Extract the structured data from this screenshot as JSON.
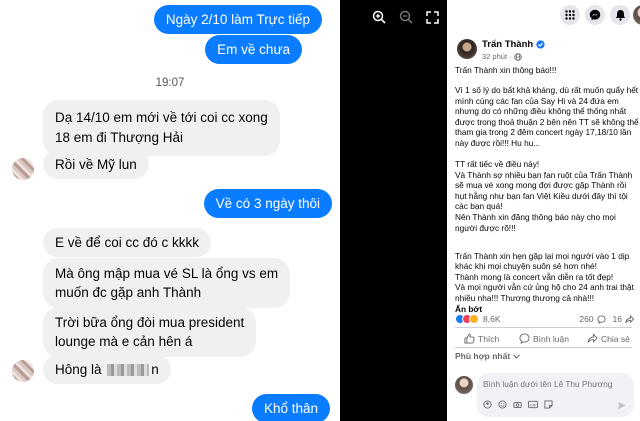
{
  "chat": {
    "messages": [
      {
        "side": "out",
        "text": "Ngày 2/10 làm Trực tiếp"
      },
      {
        "side": "out",
        "text": "Em về chưa"
      },
      {
        "side": "in",
        "text": "Dạ 14/10 em mới về tới coi cc xong"
      },
      {
        "side": "in",
        "text": "18 em đi Thượng Hải"
      },
      {
        "side": "in",
        "text": "Rồi về Mỹ lun"
      },
      {
        "side": "out",
        "text": "Về có 3 ngày thôi"
      },
      {
        "side": "in",
        "text": "E về để coi cc đó c kkkk"
      },
      {
        "side": "in",
        "text": "Mà ông mập mua vé SL là ổng vs em"
      },
      {
        "side": "in",
        "text": "muốn đc gặp anh Thành"
      },
      {
        "side": "in",
        "text": "Trời bữa ổng đòi mua president"
      },
      {
        "side": "in",
        "text": "lounge mà e cản hên á"
      },
      {
        "side": "in",
        "text_a": "Hông là ",
        "text_b": "n"
      },
      {
        "side": "out",
        "text": "Khổ thân"
      }
    ],
    "timestamp": "19:07"
  },
  "post": {
    "author": "Trấn Thành",
    "verified": true,
    "time": "32 phút",
    "audience_icon": "globe-icon",
    "paragraphs": [
      "Trấn Thành xin thông báo!!!",
      "Vì 1 số lý do bất khả kháng, dù rất muốn quẩy hết mình cùng các fan của Say Hi và 24 đứa em nhưng do có những điều không thể thống nhất được trong thoả thuận 2 bên nên TT sẽ không thể tham gia trong 2 đêm concert ngày 17,18/10 lần này được rồi!!! Hu hu...",
      "TT rất tiếc về điều này!\nVà Thành sợ nhiều bạn fan ruột của Trấn Thành sẽ mua vé xong mong đợi được gặp Thành rồi hụt hẫng như bạn fan Việt Kiều dưới đây thì tội các bạn quá!\nNên Thành xin đăng thông báo này cho mọi người được rõ!!!",
      "Trấn Thành xin hẹn gặp lại mọi người vào 1 dịp khác khi mọi chuyện suôn sẻ hơn nhé!\nThành mong là concert vẫn diễn ra tốt đẹp!\nVà mọi người vẫn cứ ủng hộ cho 24 anh trai thật nhiều nha!!! Thương thương cả nhà!!!"
    ],
    "see_more": "Ẩn bớt",
    "reactions_count": "8,6K",
    "comments_count": "260",
    "shares_count": "16",
    "actions": {
      "like": "Thích",
      "comment": "Bình luận",
      "share": "Chia sẻ"
    },
    "filter": "Phù hợp nhất",
    "comment_placeholder": "Bình luận dưới tên Lê Thu Phương"
  },
  "colors": {
    "messenger_blue": "#0a7cff",
    "fb_blue": "#1877f2",
    "like_blue": "#1877f2",
    "heart_red": "#f33e58",
    "haha_yellow": "#f7b125"
  }
}
